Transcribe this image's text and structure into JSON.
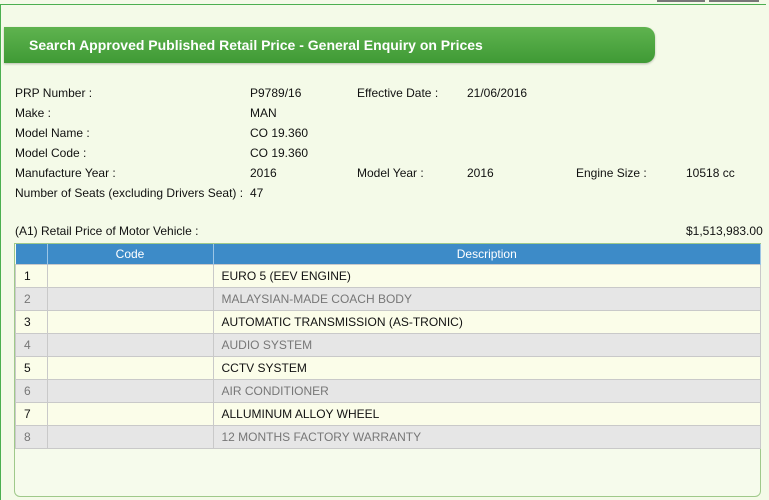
{
  "header": {
    "title": "Search Approved Published Retail Price - General Enquiry on Prices"
  },
  "details": {
    "prp_number_label": "PRP Number :",
    "prp_number": "P9789/16",
    "effective_date_label": "Effective Date :",
    "effective_date": "21/06/2016",
    "make_label": "Make :",
    "make": "MAN",
    "model_name_label": "Model Name :",
    "model_name": "CO 19.360",
    "model_code_label": "Model Code :",
    "model_code": "CO 19.360",
    "manufacture_year_label": "Manufacture Year :",
    "manufacture_year": "2016",
    "model_year_label": "Model Year :",
    "model_year": "2016",
    "engine_size_label": "Engine Size :",
    "engine_size": "10518 cc",
    "seats_label": "Number of Seats (excluding Drivers Seat) :",
    "seats": "47"
  },
  "price": {
    "label": "(A1) Retail Price of Motor Vehicle :",
    "value": "$1,513,983.00"
  },
  "table": {
    "columns": [
      "",
      "Code",
      "Description"
    ],
    "rows": [
      {
        "num": "1",
        "code": "",
        "description": "EURO 5 (EEV ENGINE)"
      },
      {
        "num": "2",
        "code": "",
        "description": "MALAYSIAN-MADE COACH BODY"
      },
      {
        "num": "3",
        "code": "",
        "description": "AUTOMATIC TRANSMISSION (AS-TRONIC)"
      },
      {
        "num": "4",
        "code": "",
        "description": "AUDIO SYSTEM"
      },
      {
        "num": "5",
        "code": "",
        "description": "CCTV SYSTEM"
      },
      {
        "num": "6",
        "code": "",
        "description": "AIR CONDITIONER"
      },
      {
        "num": "7",
        "code": "",
        "description": "ALLUMINUM ALLOY WHEEL"
      },
      {
        "num": "8",
        "code": "",
        "description": "12 MONTHS FACTORY WARRANTY"
      }
    ]
  }
}
